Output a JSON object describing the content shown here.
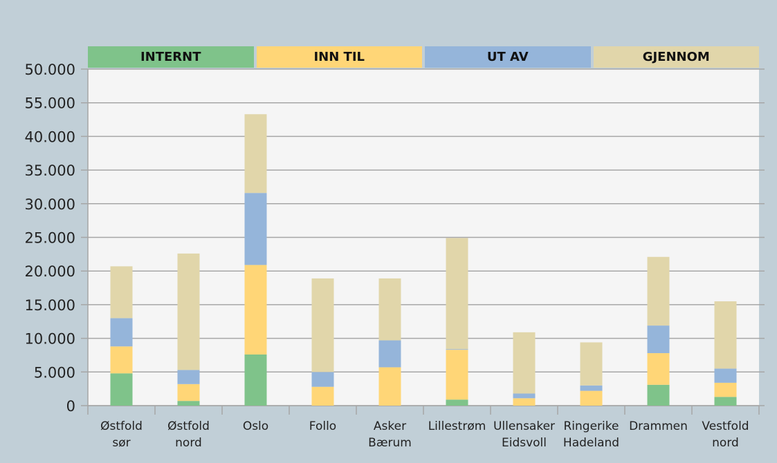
{
  "chart_data": {
    "type": "bar",
    "stacked": true,
    "title": "",
    "xlabel": "",
    "ylabel": "",
    "ylim": [
      0,
      50000
    ],
    "yticks": [
      0,
      5000,
      10000,
      15000,
      20000,
      25000,
      30000,
      35000,
      40000,
      45000,
      50000
    ],
    "ytick_labels": [
      "0",
      "5.000",
      "10.000",
      "15.000",
      "20.000",
      "25.000",
      "30.000",
      "35.000",
      "40.000",
      "55.000",
      "50.000"
    ],
    "grid": true,
    "legend_position": "top",
    "categories": [
      [
        "Østfold",
        "sør"
      ],
      [
        "Østfold",
        "nord"
      ],
      [
        "Oslo"
      ],
      [
        "Follo"
      ],
      [
        "Asker",
        "Bærum"
      ],
      [
        "Lillestrøm"
      ],
      [
        "Ullensaker",
        "Eidsvoll"
      ],
      [
        "Ringerike",
        "Hadeland"
      ],
      [
        "Drammen"
      ],
      [
        "Vestfold",
        "nord"
      ]
    ],
    "series": [
      {
        "name": "INTERNT",
        "color": "#7fc38a",
        "values": [
          4800,
          700,
          7600,
          0,
          0,
          900,
          0,
          0,
          3100,
          1300
        ]
      },
      {
        "name": "INN TIL",
        "color": "#ffd677",
        "values": [
          4000,
          2500,
          13300,
          2800,
          5700,
          7400,
          1100,
          2200,
          4700,
          2100
        ]
      },
      {
        "name": "UT AV",
        "color": "#95b5da",
        "values": [
          4200,
          2100,
          10700,
          2200,
          4000,
          100,
          700,
          800,
          4100,
          2100
        ]
      },
      {
        "name": "GJENNOM",
        "color": "#e1d6aa",
        "values": [
          7700,
          17300,
          11700,
          13900,
          9200,
          16500,
          9100,
          6400,
          10200,
          10000
        ]
      }
    ]
  }
}
